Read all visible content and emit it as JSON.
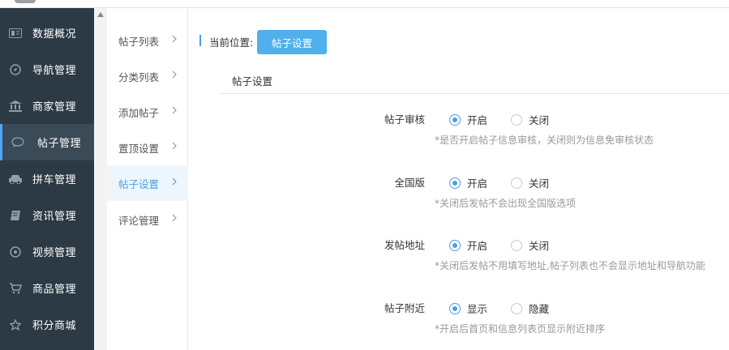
{
  "sidebar": {
    "items": [
      {
        "label": "数据概况",
        "icon": "dashboard-icon"
      },
      {
        "label": "导航管理",
        "icon": "compass-icon"
      },
      {
        "label": "商家管理",
        "icon": "bank-icon"
      },
      {
        "label": "帖子管理",
        "icon": "chat-bubble-icon"
      },
      {
        "label": "拼车管理",
        "icon": "car-icon"
      },
      {
        "label": "资讯管理",
        "icon": "book-icon"
      },
      {
        "label": "视频管理",
        "icon": "play-circle-icon"
      },
      {
        "label": "商品管理",
        "icon": "cart-icon"
      },
      {
        "label": "积分商城",
        "icon": "star-icon"
      }
    ],
    "active_index": 3
  },
  "submenu": {
    "items": [
      {
        "label": "帖子列表"
      },
      {
        "label": "分类列表"
      },
      {
        "label": "添加帖子"
      },
      {
        "label": "置顶设置"
      },
      {
        "label": "帖子设置"
      },
      {
        "label": "评论管理"
      }
    ],
    "active_index": 4
  },
  "breadcrumb": {
    "label": "当前位置:",
    "current": "帖子设置"
  },
  "panel": {
    "title": "帖子设置",
    "fields": [
      {
        "label": "帖子审核",
        "options": [
          "开启",
          "关闭"
        ],
        "selected": 0,
        "hint": "*是否开启帖子信息审核，关闭则为信息免审核状态"
      },
      {
        "label": "全国版",
        "options": [
          "开启",
          "关闭"
        ],
        "selected": 0,
        "hint": "*关闭后发帖不会出现全国版选项"
      },
      {
        "label": "发帖地址",
        "options": [
          "开启",
          "关闭"
        ],
        "selected": 0,
        "hint": "*关闭后发帖不用填写地址,帖子列表也不会显示地址和导航功能"
      },
      {
        "label": "帖子附近",
        "options": [
          "显示",
          "隐藏"
        ],
        "selected": 0,
        "hint": "*开启后首页和信息列表页显示附近排序"
      }
    ]
  },
  "colors": {
    "sidebar_bg": "#2b3a44",
    "accent": "#4a9fe0",
    "button": "#4fb0ec"
  }
}
